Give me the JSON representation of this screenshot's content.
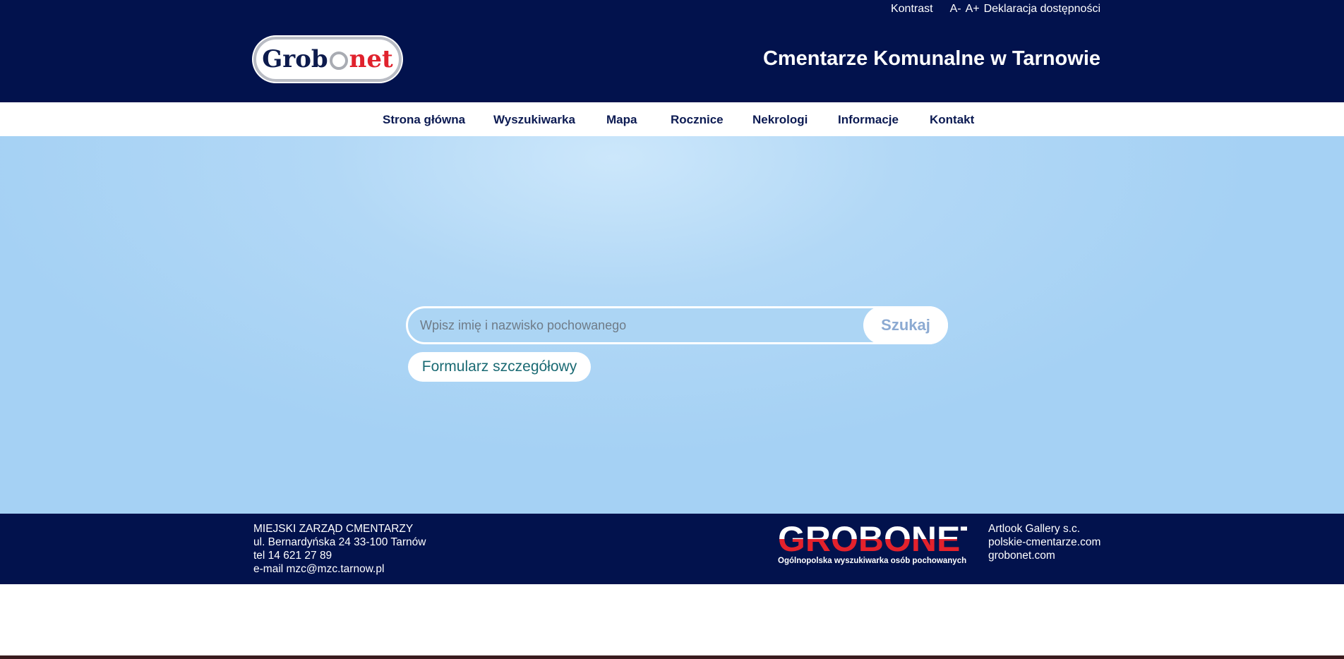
{
  "topbar": {
    "contrast": "Kontrast",
    "font_decrease": "A-",
    "font_increase": "A+",
    "accessibility": "Deklaracja dostępności"
  },
  "logo": {
    "part1": "Grob",
    "part2": "net"
  },
  "header": {
    "title": "Cmentarze Komunalne w Tarnowie"
  },
  "nav": {
    "items": [
      {
        "label": "Strona główna"
      },
      {
        "label": "Wyszukiwarka"
      },
      {
        "label": "Mapa"
      },
      {
        "label": "Rocznice"
      },
      {
        "label": "Nekrologi"
      },
      {
        "label": "Informacje"
      },
      {
        "label": "Kontakt"
      }
    ]
  },
  "search": {
    "placeholder": "Wpisz imię i nazwisko pochowanego",
    "value": "",
    "button_label": "Szukaj",
    "advanced_label": "Formularz szczegółowy"
  },
  "footer": {
    "left": [
      "MIEJSKI ZARZĄD CMENTARZY",
      "ul. Bernardyńska 24 33-100 Tarnów",
      "tel 14 621 27 89",
      "e-mail mzc@mzc.tarnow.pl"
    ],
    "brand_name": "GROBONET",
    "brand_tagline": "Ogólnopolska wyszukiwarka osób pochowanych",
    "right": [
      "Artlook Gallery s.c.",
      "polskie-cmentarze.com",
      "grobonet.com"
    ]
  },
  "colors": {
    "header_bg": "#02124d",
    "hero_bg": "#a5d1f4",
    "brand_red": "#e3222c",
    "nav_text": "#0b1a52",
    "advanced_text": "#1a6a73"
  }
}
